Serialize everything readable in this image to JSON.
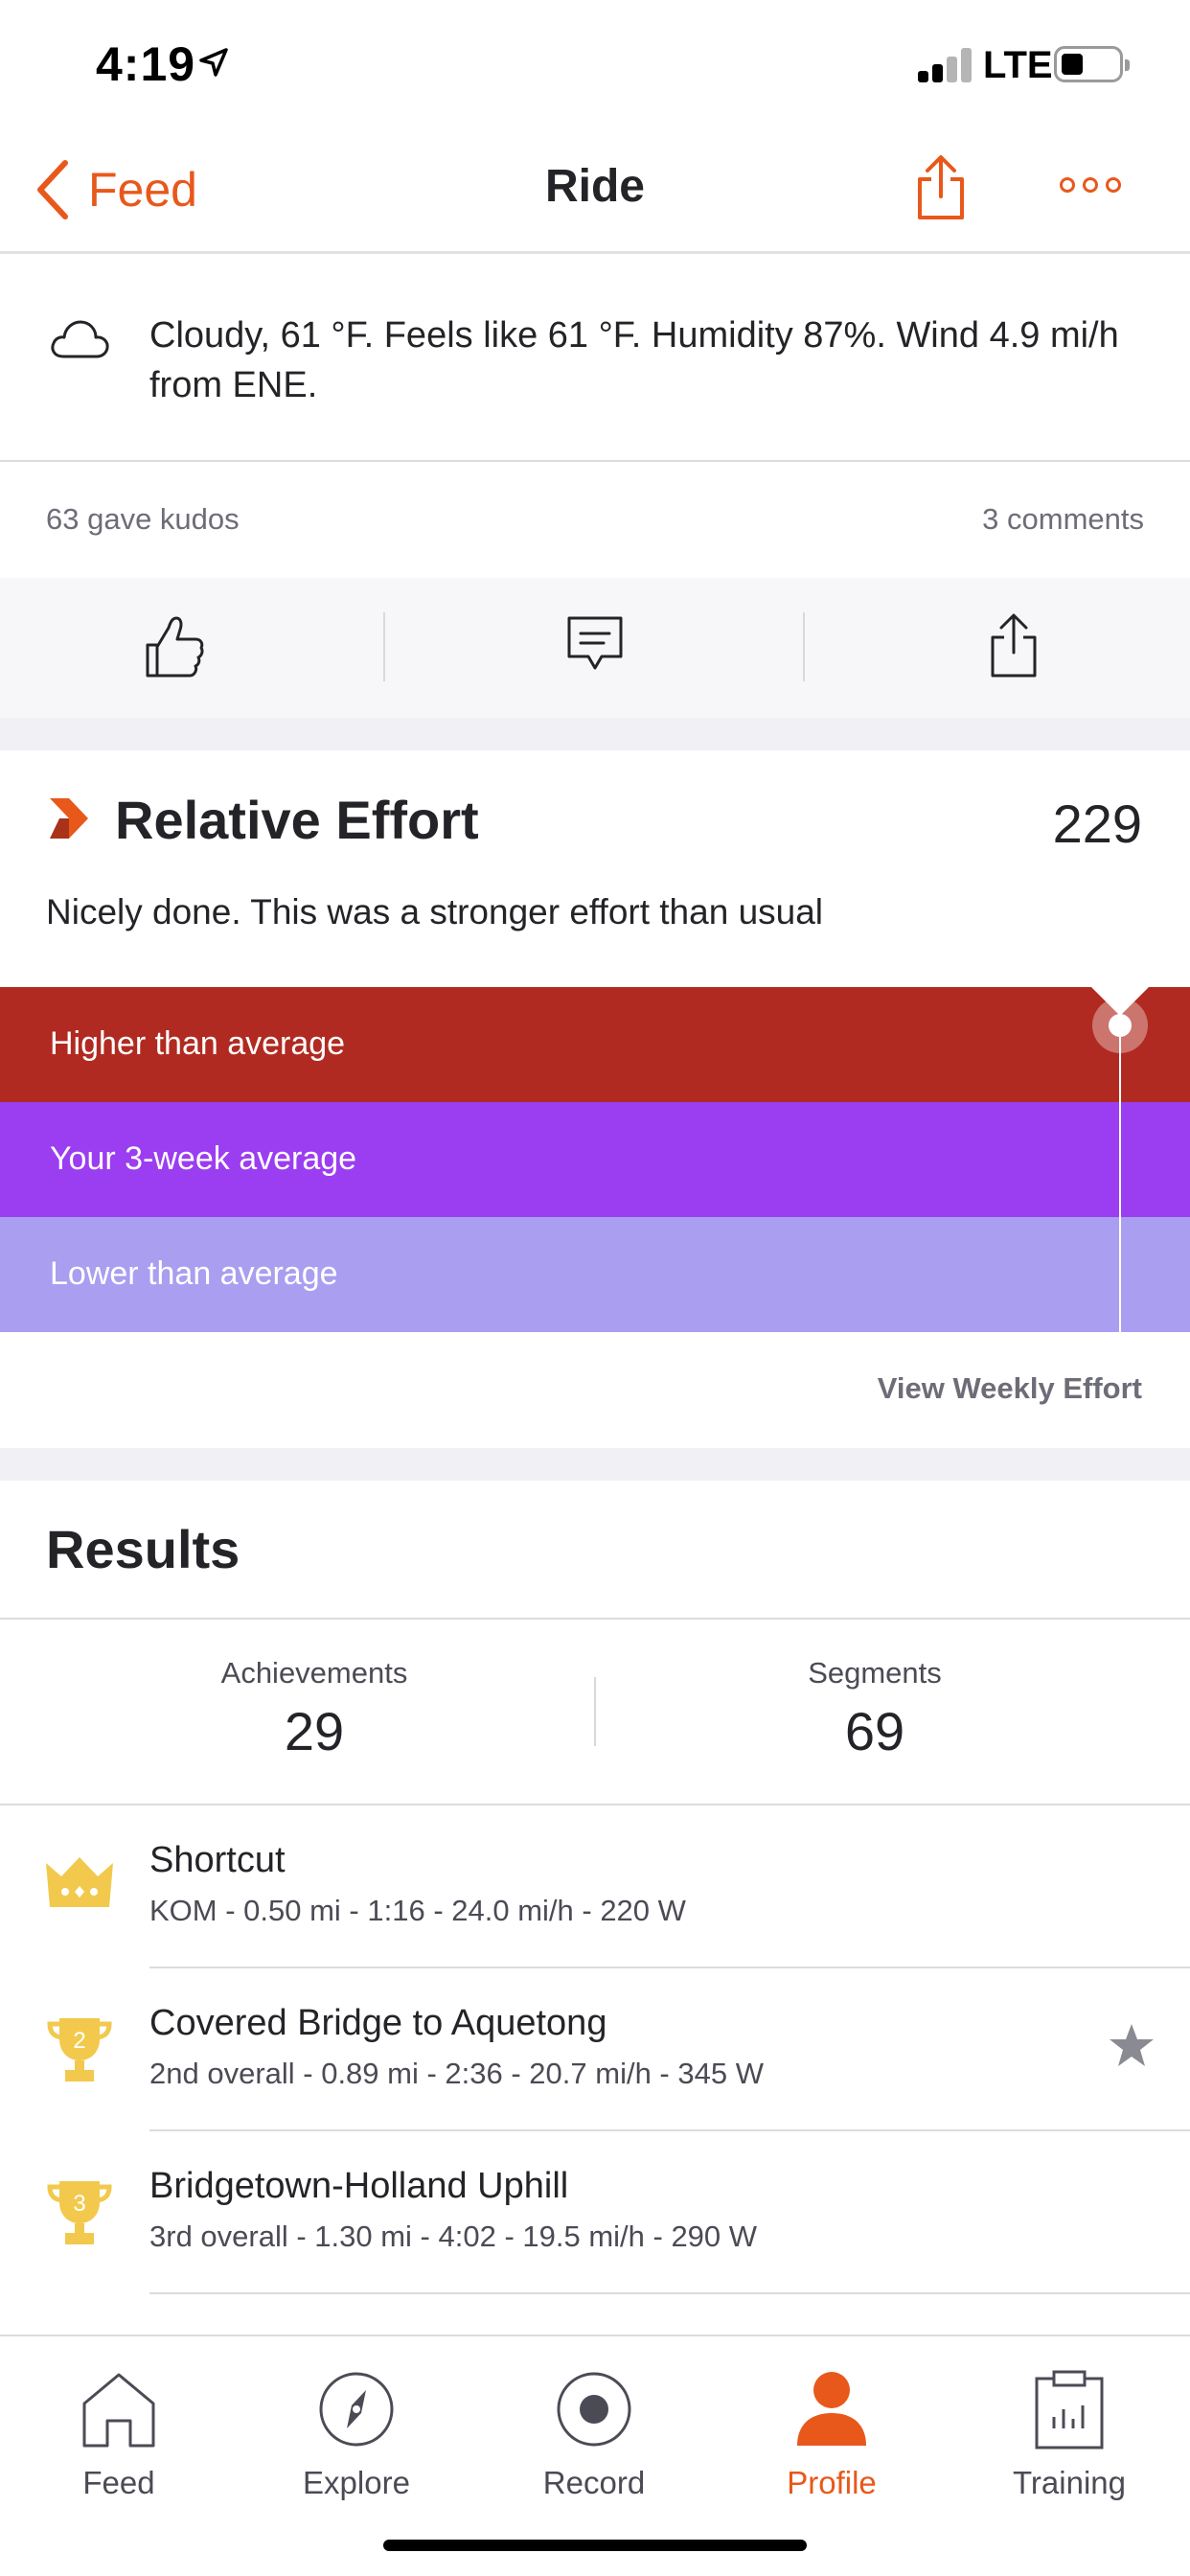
{
  "status_bar": {
    "time": "4:19",
    "network": "LTE",
    "icons": [
      "location-arrow-icon",
      "signal-icon",
      "battery-icon"
    ]
  },
  "nav": {
    "back_label": "Feed",
    "title": "Ride",
    "icons": [
      "chevron-left-icon",
      "share-icon",
      "more-icon"
    ],
    "accent_color": "#e8581b"
  },
  "weather": {
    "icon": "cloud-icon",
    "text": "Cloudy, 61 °F. Feels like 61 °F. Humidity 87%. Wind 4.9 mi/h from ENE."
  },
  "social": {
    "kudos": "63 gave kudos",
    "comments": "3 comments",
    "actions": [
      "thumbs-up-icon",
      "comment-icon",
      "share-icon"
    ]
  },
  "relative_effort": {
    "title": "Relative Effort",
    "value": "229",
    "description": "Nicely done. This was a stronger effort than usual",
    "bands": [
      {
        "label": "Higher than average",
        "color": "#b12a21"
      },
      {
        "label": "Your 3-week average",
        "color": "#9b3df0"
      },
      {
        "label": "Lower than average",
        "color": "#a99ef0"
      }
    ],
    "link": "View Weekly Effort"
  },
  "results": {
    "title": "Results",
    "stats": [
      {
        "label": "Achievements",
        "value": "29"
      },
      {
        "label": "Segments",
        "value": "69"
      }
    ],
    "segments": [
      {
        "name": "Shortcut",
        "meta": "KOM - 0.50 mi - 1:16 - 24.0 mi/h - 220 W",
        "icon": "crown-icon",
        "starred": false
      },
      {
        "name": "Covered Bridge to Aquetong",
        "meta": "2nd overall - 0.89 mi - 2:36 - 20.7 mi/h - 345 W",
        "icon": "trophy-2-icon",
        "badge": "2",
        "starred": true
      },
      {
        "name": "Bridgetown-Holland Uphill",
        "meta": "3rd overall - 1.30 mi - 4:02 - 19.5 mi/h - 290 W",
        "icon": "trophy-3-icon",
        "badge": "3",
        "starred": false
      }
    ]
  },
  "tabbar": {
    "tabs": [
      {
        "label": "Feed",
        "icon": "home-icon"
      },
      {
        "label": "Explore",
        "icon": "compass-icon"
      },
      {
        "label": "Record",
        "icon": "record-icon"
      },
      {
        "label": "Profile",
        "icon": "profile-icon",
        "active": true
      },
      {
        "label": "Training",
        "icon": "clipboard-icon"
      }
    ]
  }
}
